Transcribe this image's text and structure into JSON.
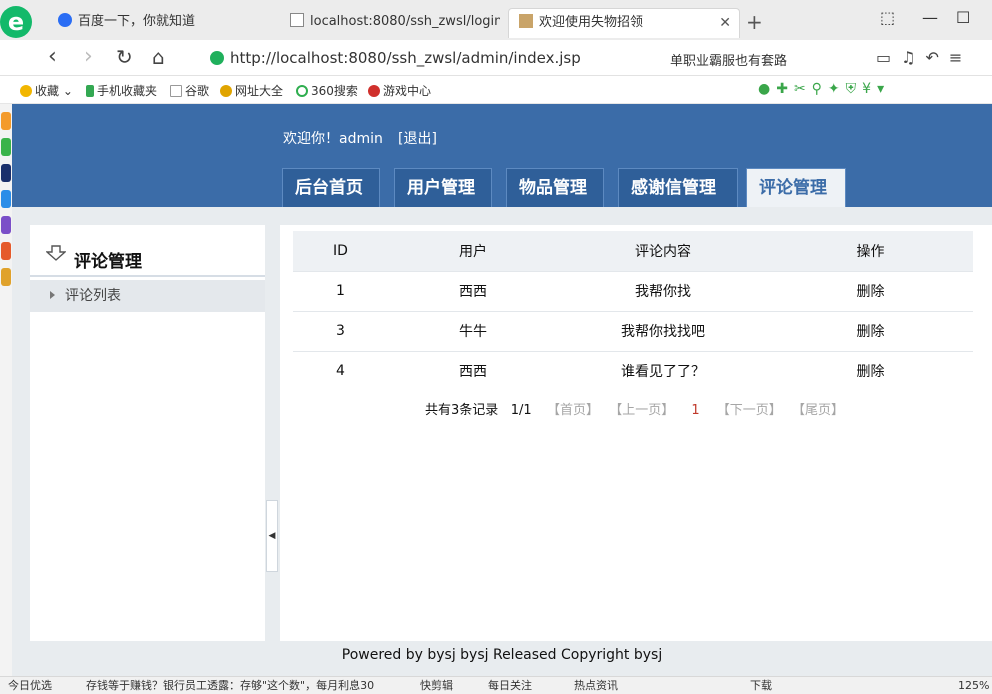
{
  "browser": {
    "tabs": [
      {
        "title": "百度一下，你就知道"
      },
      {
        "title": "localhost:8080/ssh_zwsl/login.j"
      },
      {
        "title": "欢迎使用失物招领"
      }
    ],
    "url": "http://localhost:8080/ssh_zwsl/admin/index.jsp",
    "search_hint": "单职业霸服也有套路",
    "bookmarks": [
      "收藏",
      "手机收藏夹",
      "谷歌",
      "网址大全",
      "360搜索",
      "游戏中心"
    ],
    "status": {
      "left": "今日优选",
      "news": "存钱等于赚钱？银行员工透露：存够\"这个数\"，每月利息30",
      "items": [
        "快剪辑",
        "每日关注",
        "热点资讯",
        "下载"
      ],
      "zoom": "125%"
    }
  },
  "header": {
    "welcome": "欢迎你！admin",
    "logout": "[退出]",
    "nav": {
      "home": "后台首页",
      "user": "用户管理",
      "item": "物品管理",
      "letter": "感谢信管理",
      "comment": "评论管理"
    }
  },
  "sidebar": {
    "title": "评论管理",
    "item": "评论列表"
  },
  "table": {
    "headers": [
      "ID",
      "用户",
      "评论内容",
      "操作"
    ],
    "rows": [
      {
        "id": "1",
        "user": "西西",
        "content": "我帮你找",
        "action": "删除"
      },
      {
        "id": "3",
        "user": "牛牛",
        "content": "我帮你找找吧",
        "action": "删除"
      },
      {
        "id": "4",
        "user": "西西",
        "content": "谁看见了了？",
        "action": "删除"
      }
    ]
  },
  "pager": {
    "summary": "共有3条记录",
    "pages": "1/1",
    "first": "【首页】",
    "prev": "【上一页】",
    "current": "1",
    "next": "【下一页】",
    "last": "【尾页】"
  },
  "footer": "Powered by bysj bysj Released  Copyright bysj",
  "colors": {
    "header": "#3b6ca8",
    "active_tab": "#eef2f6",
    "page_bg": "#e8ecef"
  }
}
